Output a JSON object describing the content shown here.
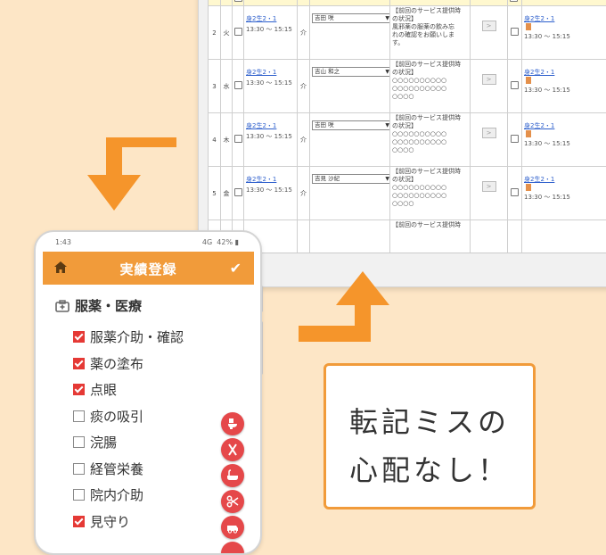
{
  "pc_table": {
    "rows": [
      {
        "no": "2",
        "day": "火",
        "service_code": "身2生2・1",
        "time": "13:30 〜 15:15",
        "svc_type": "介",
        "staff": "吉田 咲",
        "note_lines": [
          "【前回のサービス提供時",
          "の状況】",
          "風邪薬の服薬の飲み忘",
          "れの確認をお願いしま",
          "す。"
        ],
        "next_code": "身2生2・1",
        "next_time": "13:30 〜 15:15"
      },
      {
        "no": "3",
        "day": "水",
        "service_code": "身2生2・1",
        "time": "13:30 〜 15:15",
        "svc_type": "介",
        "staff": "吉山 和之",
        "note_lines": [
          "【前回のサービス提供時",
          "の状況】",
          "○○○○○○○○○○",
          "○○○○○○○○○○",
          "○○○○"
        ],
        "next_code": "身2生2・1",
        "next_time": "13:30 〜 15:15"
      },
      {
        "no": "4",
        "day": "木",
        "service_code": "身2生2・1",
        "time": "13:30 〜 15:15",
        "svc_type": "介",
        "staff": "吉田 咲",
        "note_lines": [
          "【前回のサービス提供時",
          "の状況】",
          "○○○○○○○○○○",
          "○○○○○○○○○○",
          "○○○○"
        ],
        "next_code": "身2生2・1",
        "next_time": "13:30 〜 15:15"
      },
      {
        "no": "5",
        "day": "金",
        "service_code": "身2生2・1",
        "time": "13:30 〜 15:15",
        "svc_type": "介",
        "staff": "吉見 沙紀",
        "note_lines": [
          "【前回のサービス提供時",
          "の状況】",
          "○○○○○○○○○○",
          "○○○○○○○○○○",
          "○○○○"
        ],
        "next_code": "身2生2・1",
        "next_time": "13:30 〜 15:15"
      }
    ],
    "partial_row_note": "【前回のサービス提供時"
  },
  "phone": {
    "status_time": "1:43",
    "status_signal": "4G",
    "status_battery": "42%",
    "header_title": "実績登録",
    "home_icon": "home-icon",
    "confirm_icon": "checkmark-icon",
    "section_title": "服薬・医療",
    "items": [
      {
        "label": "服薬介助・確認",
        "checked": true
      },
      {
        "label": "薬の塗布",
        "checked": true
      },
      {
        "label": "点眼",
        "checked": true
      },
      {
        "label": "痰の吸引",
        "checked": false
      },
      {
        "label": "浣腸",
        "checked": false
      },
      {
        "label": "経管栄養",
        "checked": false
      },
      {
        "label": "院内介助",
        "checked": false
      },
      {
        "label": "見守り",
        "checked": true
      }
    ],
    "side_buttons": [
      "toilet-icon",
      "meal-icon",
      "bath-icon",
      "scissors-icon",
      "car-icon"
    ]
  },
  "callout": {
    "line1": "転記ミスの",
    "line2": "心配なし！"
  },
  "colors": {
    "accent": "#f19b3a",
    "background": "#fde6c6",
    "check_red": "#e53935",
    "fab_red": "#e5484a",
    "link_blue": "#2d5fcc"
  }
}
